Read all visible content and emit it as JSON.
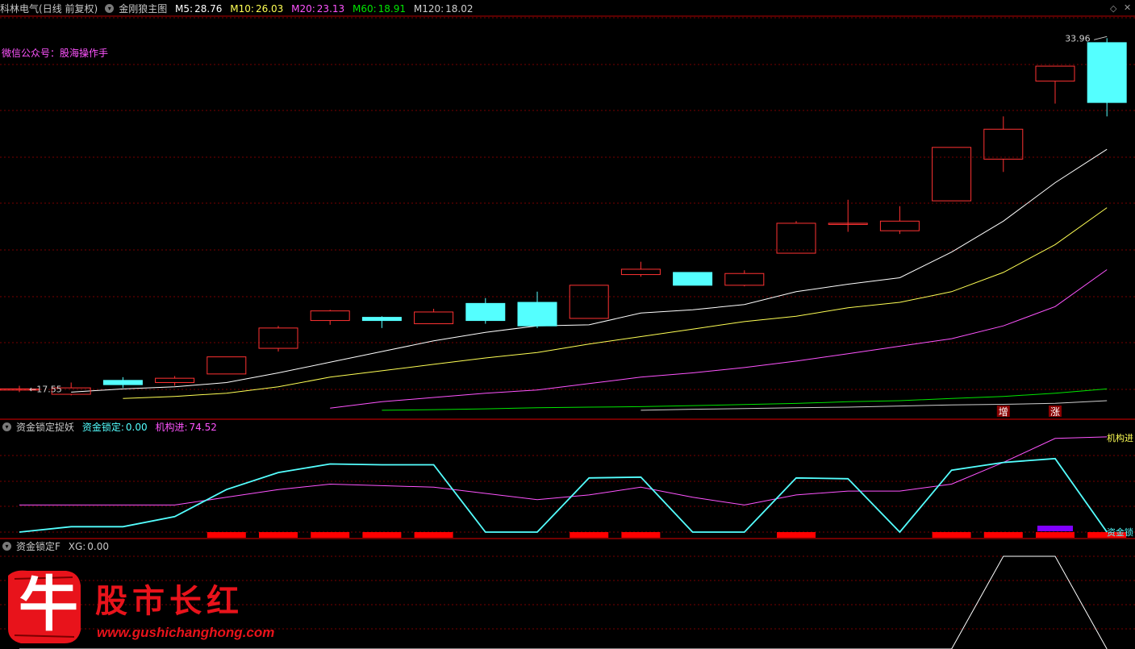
{
  "colors": {
    "bg": "#000000",
    "up_candle": "#ff3232",
    "down_candle": "#54ffff",
    "ma5": "#ffffff",
    "ma10": "#ffff54",
    "ma20": "#ff54ff",
    "ma60": "#00e600",
    "ma120": "#cfcfcf",
    "separator": "#b40000",
    "grid": "#780000",
    "fund_lock_line": "#54ffff",
    "institution_line": "#ff54ff",
    "red_bar": "#ff0000",
    "purple_bar": "#8000ff",
    "xg_line": "#ffffff",
    "watermark": "#e8131b"
  },
  "main_panel": {
    "stock_name": "科林电气",
    "period": "(日线 前复权)",
    "indicator_name": "金刚狼主图",
    "ma": [
      {
        "label": "M5:",
        "value": "28.76"
      },
      {
        "label": "M10:",
        "value": "26.03"
      },
      {
        "label": "M20:",
        "value": "23.13"
      },
      {
        "label": "M60:",
        "value": "18.91"
      },
      {
        "label": "M120:",
        "value": "18.02"
      }
    ],
    "wechat_text": "微信公众号：股海操作手",
    "high_label": "33.96",
    "low_label": "17.55",
    "signal_labels": [
      "增",
      "涨"
    ]
  },
  "fund_panel": {
    "indicator_name": "资金锁定捉妖",
    "fund_lock_label": "资金锁定:",
    "fund_lock_value": "0.00",
    "institution_label": "机构进:",
    "institution_value": "74.52",
    "right_label_top": "机构进",
    "right_label_bottom": "资金锁"
  },
  "xg_panel": {
    "indicator_name": "资金锁定F",
    "xg_label": "XG:",
    "xg_value": "0.00"
  },
  "watermark": {
    "logo_char": "牛",
    "title": "股市长红",
    "url": "www.gushichanghong.com"
  },
  "chart_data": {
    "type": "candlestick",
    "ylim": [
      17.0,
      34.5
    ],
    "candles": [
      {
        "o": 17.55,
        "c": 17.55,
        "h": 17.7,
        "l": 17.4
      },
      {
        "o": 17.3,
        "c": 17.6,
        "h": 17.85,
        "l": 17.25
      },
      {
        "o": 17.95,
        "c": 17.75,
        "h": 18.1,
        "l": 17.6
      },
      {
        "o": 17.85,
        "c": 18.05,
        "h": 18.15,
        "l": 17.7
      },
      {
        "o": 18.25,
        "c": 19.05,
        "h": 19.05,
        "l": 18.25
      },
      {
        "o": 19.45,
        "c": 20.4,
        "h": 20.5,
        "l": 19.3
      },
      {
        "o": 20.75,
        "c": 21.2,
        "h": 21.25,
        "l": 20.55
      },
      {
        "o": 20.9,
        "c": 20.75,
        "h": 20.95,
        "l": 20.4
      },
      {
        "o": 20.6,
        "c": 21.15,
        "h": 21.3,
        "l": 20.6
      },
      {
        "o": 21.55,
        "c": 20.75,
        "h": 21.8,
        "l": 20.6
      },
      {
        "o": 21.6,
        "c": 20.5,
        "h": 22.1,
        "l": 20.4
      },
      {
        "o": 20.85,
        "c": 22.4,
        "h": 22.4,
        "l": 20.85
      },
      {
        "o": 22.9,
        "c": 23.15,
        "h": 23.5,
        "l": 22.8
      },
      {
        "o": 23.0,
        "c": 22.4,
        "h": 23.0,
        "l": 22.4
      },
      {
        "o": 22.4,
        "c": 22.95,
        "h": 23.1,
        "l": 22.35
      },
      {
        "o": 23.9,
        "c": 25.3,
        "h": 25.4,
        "l": 23.9
      },
      {
        "o": 25.3,
        "c": 25.3,
        "h": 26.4,
        "l": 24.9
      },
      {
        "o": 24.95,
        "c": 25.4,
        "h": 26.1,
        "l": 24.8
      },
      {
        "o": 26.35,
        "c": 28.85,
        "h": 28.85,
        "l": 26.35
      },
      {
        "o": 28.3,
        "c": 29.7,
        "h": 30.3,
        "l": 27.7
      },
      {
        "o": 31.95,
        "c": 32.65,
        "h": 32.65,
        "l": 30.9
      },
      {
        "o": 33.75,
        "c": 30.95,
        "h": 33.96,
        "l": 30.3
      }
    ],
    "ma5": [
      null,
      17.4,
      17.55,
      17.65,
      17.85,
      18.3,
      18.8,
      19.3,
      19.8,
      20.2,
      20.5,
      20.55,
      21.1,
      21.25,
      21.5,
      22.1,
      22.45,
      22.75,
      23.95,
      25.4,
      27.2,
      28.76
    ],
    "ma10": [
      null,
      null,
      17.1,
      17.2,
      17.35,
      17.65,
      18.1,
      18.4,
      18.7,
      19.0,
      19.25,
      19.65,
      20.0,
      20.35,
      20.7,
      20.95,
      21.35,
      21.6,
      22.1,
      23.0,
      24.3,
      26.03
    ],
    "ma20": [
      null,
      null,
      null,
      null,
      null,
      null,
      16.65,
      16.95,
      17.15,
      17.35,
      17.5,
      17.8,
      18.1,
      18.3,
      18.55,
      18.85,
      19.2,
      19.55,
      19.9,
      20.5,
      21.4,
      23.13
    ],
    "ma60": [
      null,
      null,
      null,
      null,
      null,
      null,
      null,
      16.55,
      16.58,
      16.62,
      16.67,
      16.7,
      16.72,
      16.77,
      16.82,
      16.87,
      16.95,
      17.0,
      17.1,
      17.2,
      17.35,
      17.55
    ],
    "ma120": [
      null,
      null,
      null,
      null,
      null,
      null,
      null,
      null,
      null,
      null,
      null,
      null,
      16.55,
      16.6,
      16.63,
      16.67,
      16.7,
      16.75,
      16.8,
      16.83,
      16.88,
      17.0
    ],
    "fund_lock": [
      0,
      7,
      7,
      20,
      55,
      77,
      88,
      87,
      87,
      0,
      0,
      70,
      71,
      0,
      0,
      70,
      69,
      0,
      80,
      90,
      95,
      0
    ],
    "institution": [
      35,
      35,
      35,
      35,
      45,
      55,
      62,
      60,
      58,
      50,
      42,
      48,
      58,
      45,
      35,
      48,
      53,
      53,
      62,
      90,
      121,
      123
    ],
    "red_bars": [
      false,
      false,
      false,
      false,
      true,
      true,
      true,
      true,
      true,
      false,
      false,
      true,
      true,
      false,
      false,
      true,
      false,
      false,
      true,
      true,
      true,
      true
    ],
    "purple_bar_index": 20,
    "xg": [
      0,
      0,
      0,
      0,
      0,
      0,
      0,
      0,
      0,
      0,
      0,
      0,
      0,
      0,
      0,
      0,
      0,
      0,
      0,
      1,
      1,
      0
    ]
  }
}
